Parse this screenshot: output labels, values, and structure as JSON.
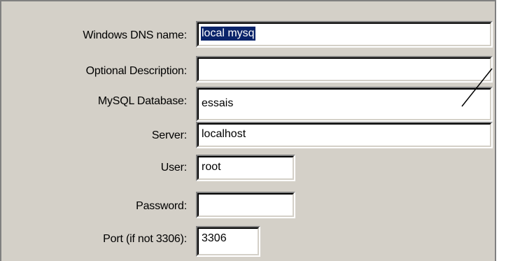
{
  "form": {
    "fields": [
      {
        "label": "Windows DNS name:",
        "value": "local mysq",
        "selected": true
      },
      {
        "label": "Optional Description:",
        "value": ""
      },
      {
        "label": "MySQL Database:",
        "value": "essais"
      },
      {
        "label": "Server:",
        "value": "localhost"
      },
      {
        "label": "User:",
        "value": "root"
      },
      {
        "label": "Password:",
        "value": ""
      },
      {
        "label": "Port (if not 3306):",
        "value": "3306"
      }
    ]
  },
  "colors": {
    "dialog_bg": "#d4d0c8",
    "selection_bg": "#0a246a",
    "selection_fg": "#ffffff"
  }
}
